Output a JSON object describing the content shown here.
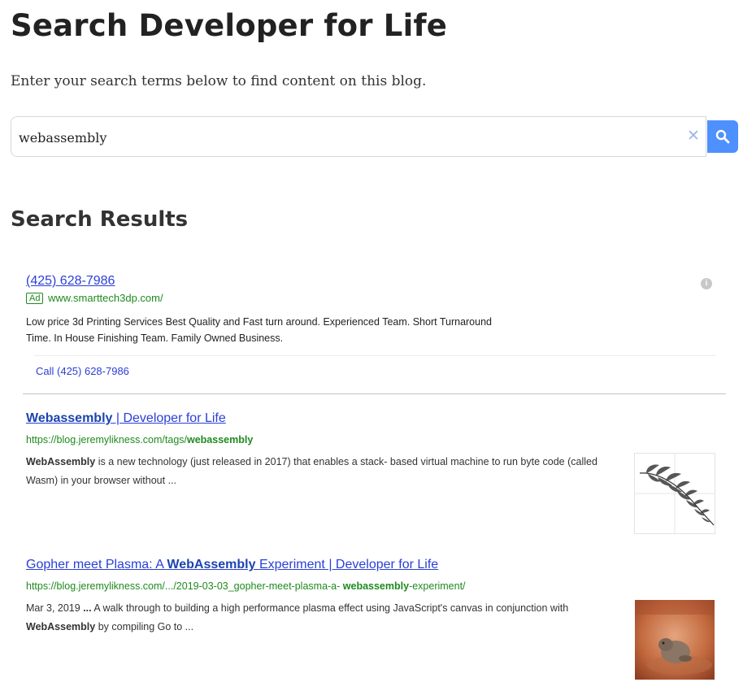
{
  "header": {
    "title": "Search Developer for Life",
    "intro": "Enter your search terms below to find content on this blog."
  },
  "search": {
    "value": "webassembly",
    "clear_glyph": "✕",
    "clear_icon": "close-icon",
    "button_icon": "search-icon",
    "accent_color": "#4d90fe"
  },
  "results_heading": "Search Results",
  "ad": {
    "title": "(425) 628-7986",
    "badge": "Ad",
    "url": "www.smarttech3dp.com/",
    "description_line1": "Low price 3d Printing Services Best Quality and Fast turn around. Experienced Team. Short Turnaround",
    "description_line2": "Time. In House Finishing Team. Family Owned Business.",
    "call_link": "Call (425) 628-7986",
    "info_icon": "info-icon"
  },
  "results": [
    {
      "title_bold": "Webassembly",
      "title_rest": " | Developer for Life",
      "url_prefix": "https://blog.jeremylikness.com/tags/",
      "url_bold": "webassembly",
      "url_suffix": "",
      "snippet_prefix": "",
      "snippet_bold": "WebAssembly",
      "snippet_rest": " is a new technology (just released in 2017) that enables a stack- based virtual machine to run byte code (called Wasm) in your browser without ...",
      "thumbnail": "fern-fractal-thumbnail"
    },
    {
      "title_prefix": "Gopher meet Plasma: A ",
      "title_bold": "WebAssembly",
      "title_rest": " Experiment | Developer for Life",
      "url_prefix": "https://blog.jeremylikness.com/.../2019-03-03_gopher-meet-plasma-a- ",
      "url_bold": "webassembly",
      "url_suffix": "-experiment/",
      "snippet_date": "Mar 3, 2019",
      "snippet_ellipsis": "...",
      "snippet_text": " A walk through to building a high performance plasma effect using JavaScript's canvas in conjunction with ",
      "snippet_bold": "WebAssembly",
      "snippet_rest": " by compiling Go to ...",
      "thumbnail": "gopher-photo-thumbnail"
    }
  ]
}
